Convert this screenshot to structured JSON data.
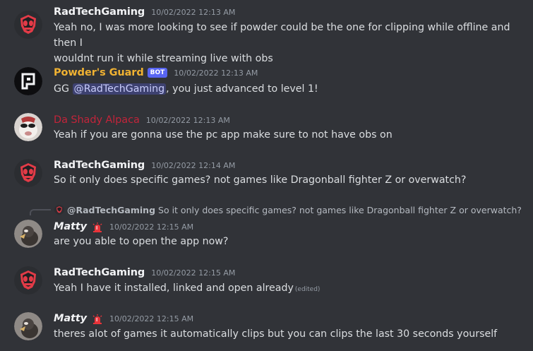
{
  "messages": [
    {
      "author": "RadTechGaming",
      "author_color": "#f2f3f5",
      "timestamp": "10/02/2022 12:13 AM",
      "lines": [
        "Yeah no, I was more looking to see if powder could be the one for clipping while offline and then I",
        "wouldnt run it while streaming live with obs"
      ]
    },
    {
      "author": "Powder's Guard",
      "author_color": "#f0b232",
      "bot_tag": "BOT",
      "timestamp": "10/02/2022 12:13 AM",
      "text_before": "GG ",
      "mention": "@RadTechGaming",
      "text_after": ", you just advanced to level 1!"
    },
    {
      "author": "Da Shady Alpaca",
      "author_color": "#c2243a",
      "timestamp": "10/02/2022 12:13 AM",
      "text": "Yeah if you are gonna use the pc app make sure to not have obs on"
    },
    {
      "author": "RadTechGaming",
      "author_color": "#f2f3f5",
      "timestamp": "10/02/2022 12:14 AM",
      "text": "So it only does specific games? not games like Dragonball fighter Z or overwatch?"
    },
    {
      "reply": {
        "author": "@RadTechGaming",
        "text": "So it only does specific games? not games like Dragonball fighter Z or overwatch?"
      },
      "author": "Matty",
      "author_color": "#f2f3f5",
      "timestamp": "10/02/2022 12:15 AM",
      "text": "are you able to open the app now?"
    },
    {
      "author": "RadTechGaming",
      "author_color": "#f2f3f5",
      "timestamp": "10/02/2022 12:15 AM",
      "text": "Yeah I have it installed, linked and open already",
      "edited": "(edited)"
    },
    {
      "author": "Matty",
      "author_color": "#f2f3f5",
      "timestamp": "10/02/2022 12:15 AM",
      "text": "theres alot of games it automatically clips but you can clips the last 30 seconds yourself"
    }
  ],
  "colors": {
    "background": "#313338",
    "timestamp": "#949ba4",
    "bot_tag": "#5865f2",
    "mention_bg": "#3c4270",
    "alarm": "#e8343a"
  },
  "icons": {
    "radtech_avatar": "red-skull-logo-icon",
    "powder_avatar": "powder-logo-icon",
    "alpaca_avatar": "alpaca-photo-avatar",
    "matty_avatar": "bird-photo-avatar",
    "role_badge": "alarm-siren-icon"
  }
}
